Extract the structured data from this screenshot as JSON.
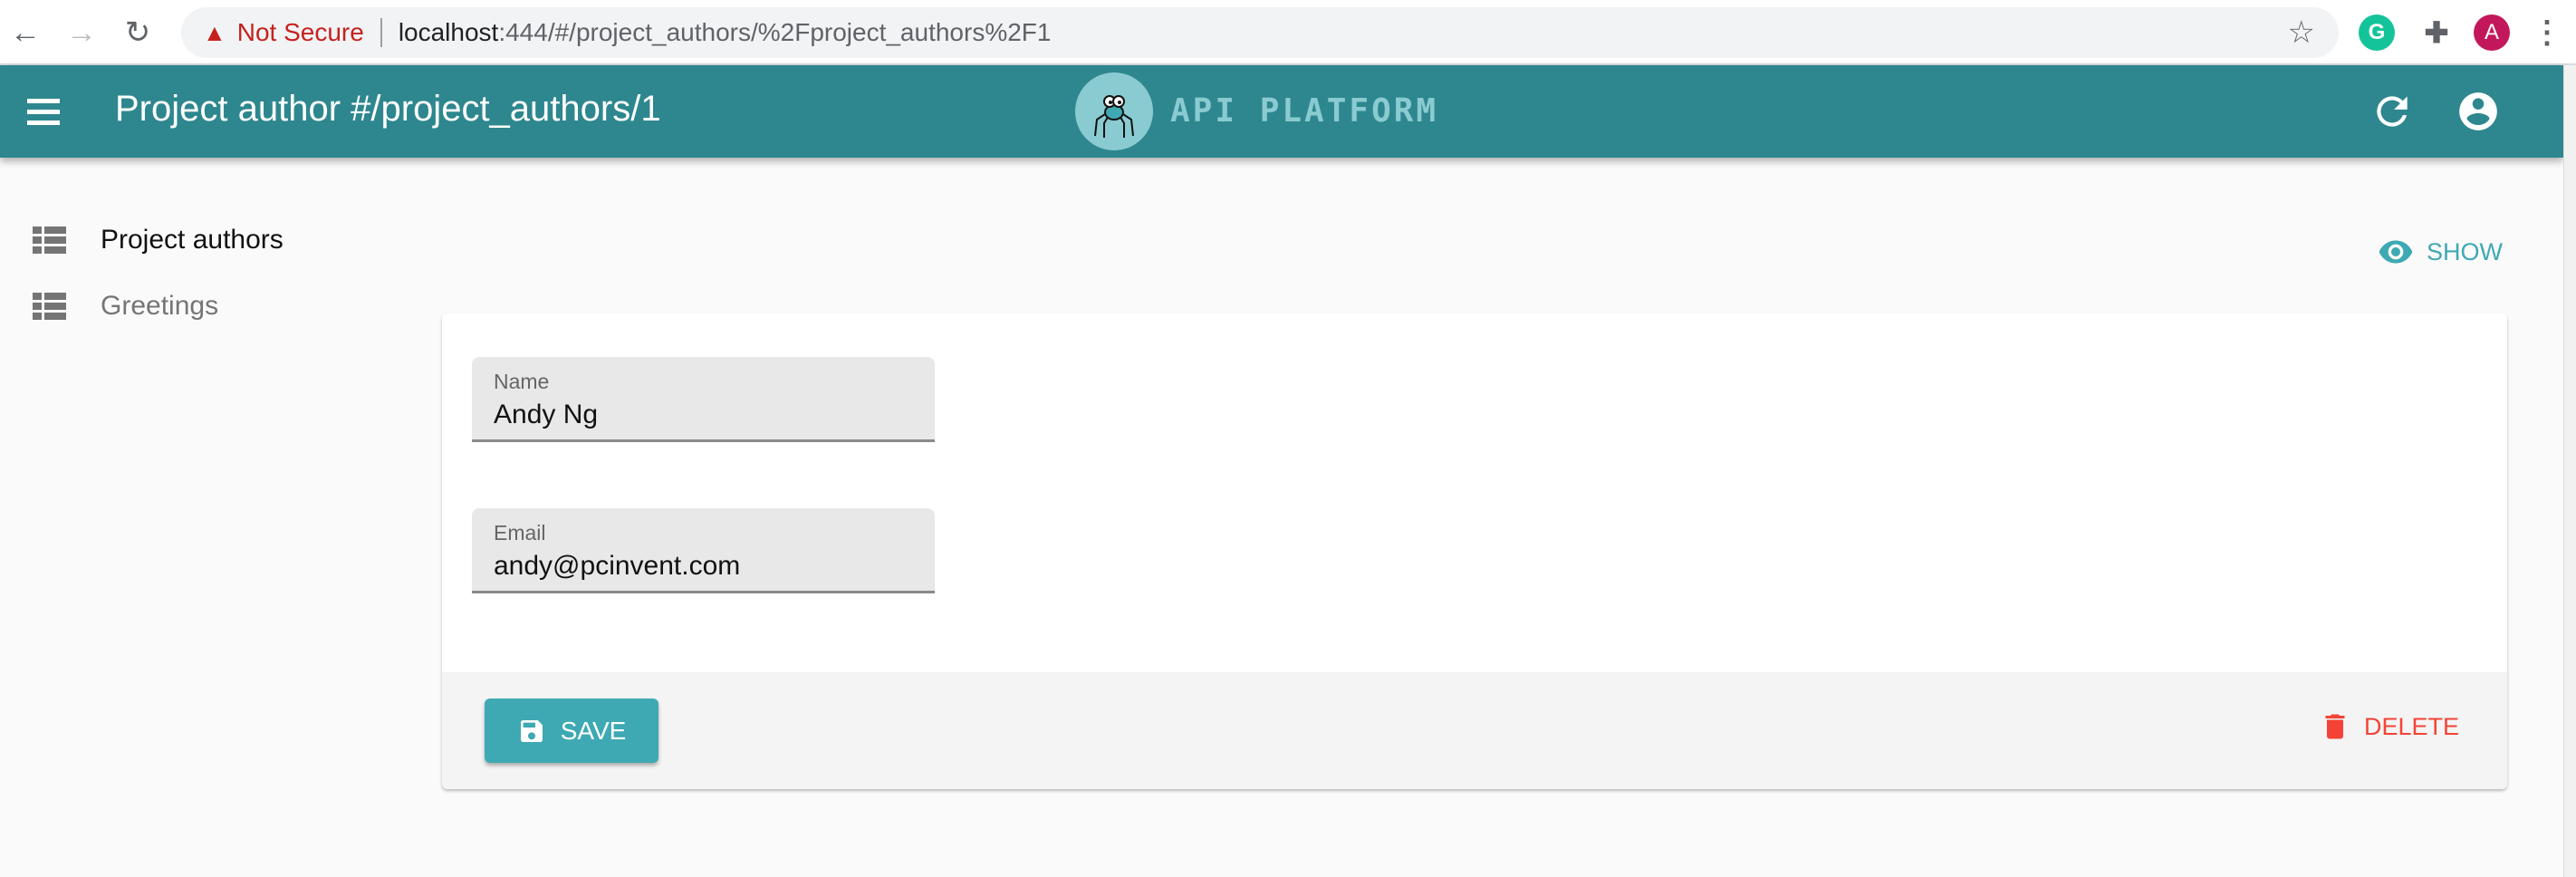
{
  "browser": {
    "security_label": "Not Secure",
    "url_host": "localhost",
    "url_path": ":444/#/project_authors/%2Fproject_authors%2F1",
    "profile_initial": "A",
    "grammarly_initial": "G"
  },
  "appbar": {
    "title": "Project author #/project_authors/1",
    "logo_text": "API PLATFORM"
  },
  "sidebar": {
    "items": [
      {
        "label": "Project authors",
        "active": true
      },
      {
        "label": "Greetings",
        "active": false
      }
    ]
  },
  "actions": {
    "show_label": "SHOW"
  },
  "form": {
    "fields": [
      {
        "label": "Name",
        "value": "Andy Ng"
      },
      {
        "label": "Email",
        "value": "andy@pcinvent.com"
      }
    ],
    "save_label": "SAVE",
    "delete_label": "DELETE"
  },
  "colors": {
    "primary": "#2e878e",
    "accent": "#3ea9b3",
    "danger": "#f44336"
  }
}
